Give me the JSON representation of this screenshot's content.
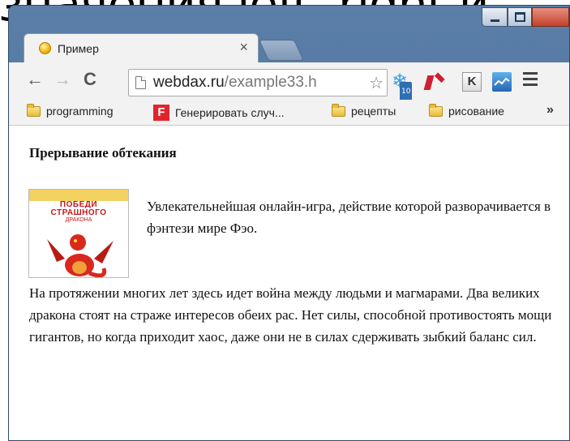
{
  "slide_caption": "значения left, right и",
  "window": {
    "minimize_label": "",
    "maximize_label": "",
    "close_label": "x"
  },
  "tab": {
    "title": "Пример",
    "close": "×"
  },
  "toolbar": {
    "back": "←",
    "forward": "→",
    "reload": "C",
    "url_domain": "webdax.ru",
    "url_path": "/example33.h",
    "bookmark_star": "☆",
    "ext_badge": "10",
    "ext_k": "K"
  },
  "bookmarks": {
    "items": [
      {
        "label": "programming",
        "type": "folder"
      },
      {
        "label": "Генерировать случ...",
        "type": "site",
        "icon_letter": "F"
      },
      {
        "label": "рецепты",
        "type": "folder"
      },
      {
        "label": "рисование",
        "type": "folder"
      }
    ],
    "more": "»"
  },
  "page": {
    "heading": "Прерывание обтекания",
    "image": {
      "title_line1": "ПОБЕДИ",
      "title_line2": "СТРАШНОГО",
      "title_line3": "ДРАКОНА"
    },
    "intro": "Увлекательнейшая онлайн-игра, действие которой разворачивается в фэнтези мире Фэо.",
    "body": "На протяжении многих лет здесь идет война между людьми и магмарами. Два великих дракона стоят на страже интересов обеих рас. Нет силы, способной противостоять мощи гигантов, но когда приходит хаос, даже они не в силах сдерживать зыбкий баланс сил."
  },
  "colors": {
    "window_frame": "#4a6f99",
    "close_button": "#c4412a",
    "dragon_red": "#c4161c",
    "cover_band": "#f2d260"
  }
}
